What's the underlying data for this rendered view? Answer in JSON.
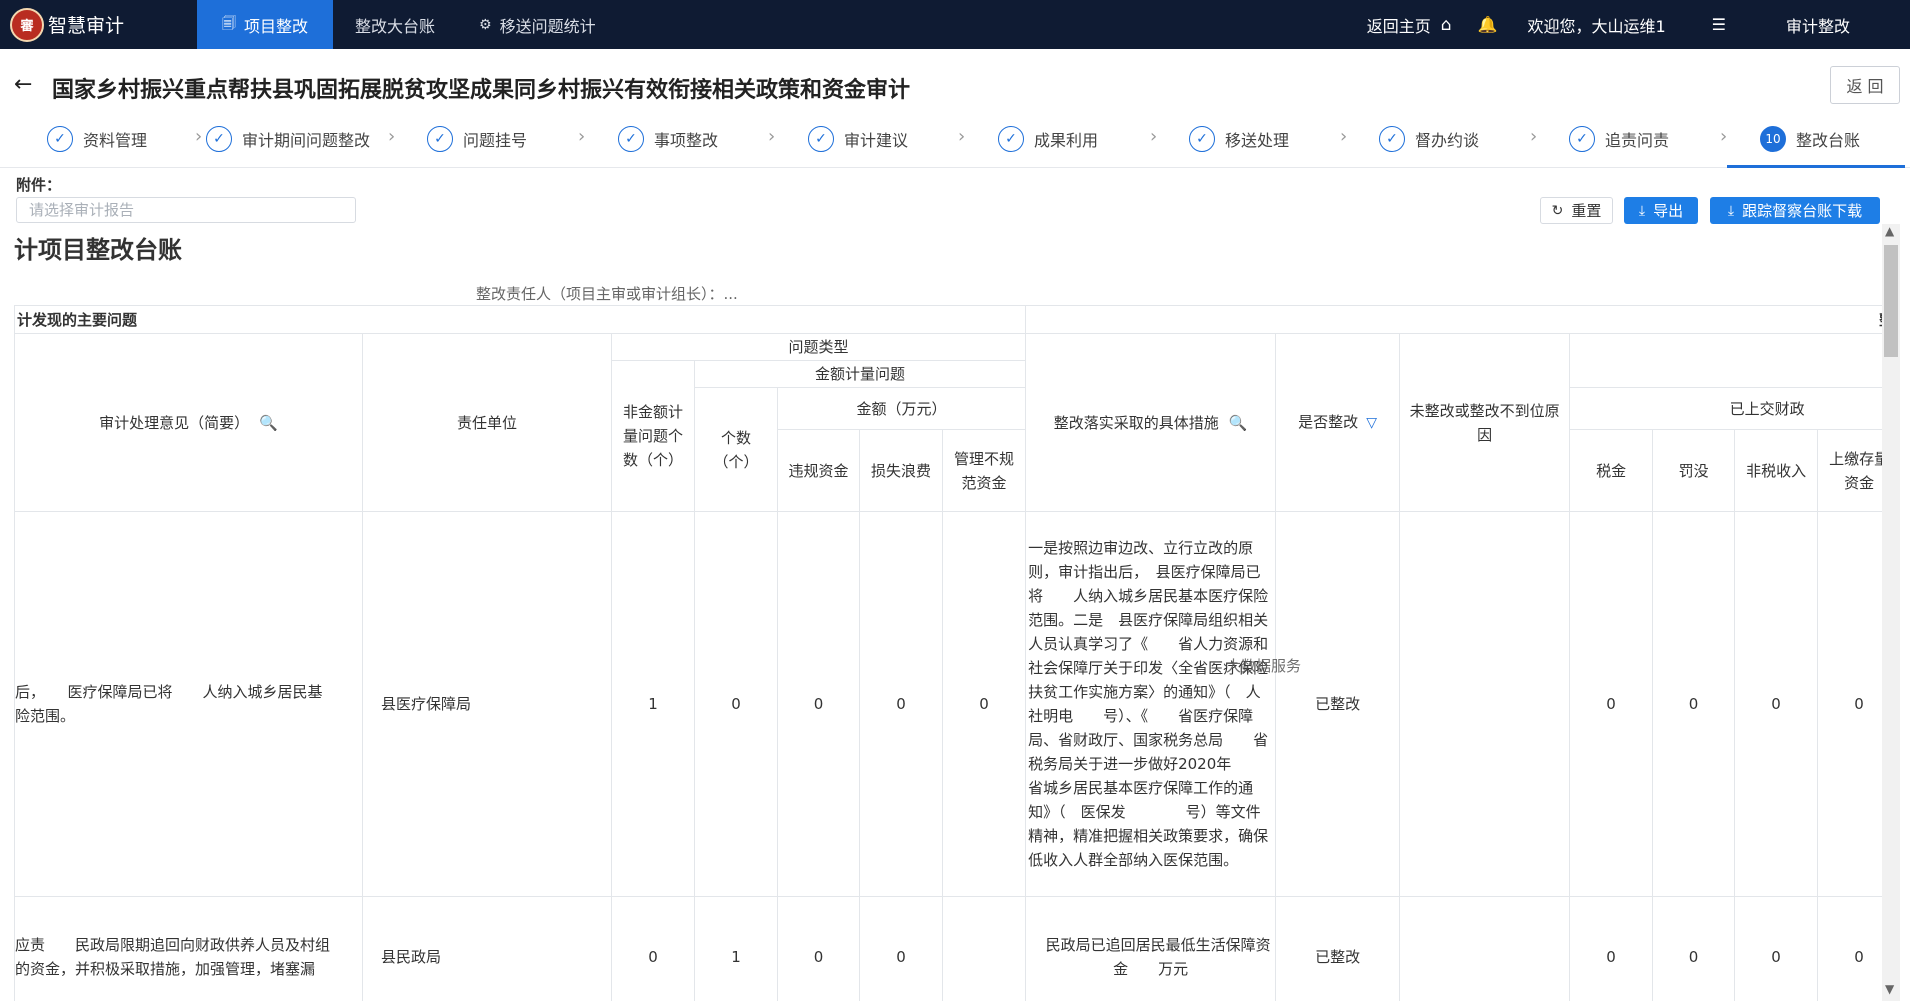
{
  "app": {
    "logo_glyph": "審",
    "name": "智慧审计"
  },
  "nav": {
    "tabs": [
      {
        "label": "项目整改",
        "active": true
      },
      {
        "label": "整改大台账",
        "active": false
      },
      {
        "label": "移送问题统计",
        "active": false
      }
    ],
    "home": "返回主页",
    "welcome": "欢迎您，大山运维1",
    "audit": "审计整改"
  },
  "title": {
    "text": "国家乡村振兴重点帮扶县巩固拓展脱贫攻坚成果同乡村振兴有效衔接相关政策和资金审计",
    "return_button": "返 回"
  },
  "steps": [
    {
      "label": "资料管理",
      "num": ""
    },
    {
      "label": "审计期间问题整改",
      "num": ""
    },
    {
      "label": "问题挂号",
      "num": ""
    },
    {
      "label": "事项整改",
      "num": ""
    },
    {
      "label": "审计建议",
      "num": ""
    },
    {
      "label": "成果利用",
      "num": ""
    },
    {
      "label": "移送处理",
      "num": ""
    },
    {
      "label": "督办约谈",
      "num": ""
    },
    {
      "label": "追责问责",
      "num": ""
    },
    {
      "label": "整改台账",
      "num": "10"
    }
  ],
  "attachment": {
    "label": "附件：",
    "placeholder": "请选择审计报告"
  },
  "buttons": {
    "reset": "重置",
    "export": "导出",
    "track_download": "跟踪督察台账下载"
  },
  "ledger": {
    "title": "计项目整改台账",
    "responsible": "整改责任人（项目主审或审计组长）：..."
  },
  "table": {
    "section_left": "计发现的主要问题",
    "section_right": "整",
    "headers": {
      "opinion": "审计处理意见（简要）",
      "unit": "责任单位",
      "problem_type": "问题类型",
      "non_amount": "非金额计量问题个数（个）",
      "amount_group": "金额计量问题",
      "count": "个数（个）",
      "amount": "金额（万元）",
      "violation": "违规资金",
      "loss": "损失浪费",
      "irregular": "管理不规范资金",
      "measures": "整改落实采取的具体措施",
      "rectified": "是否整改",
      "reason": "未整改或整改不到位原因",
      "handed": "已上交财政",
      "tax": "税金",
      "fine": "罚没",
      "nontax": "非税收入",
      "stock": "上缴存量资金"
    },
    "rows": [
      {
        "opinion": "后，　　医疗保障局已将　　人纳入城乡居民基\n险范围。",
        "unit": "县医疗保障局",
        "non_amount": "1",
        "count": "0",
        "violation": "0",
        "loss": "0",
        "irregular": "0",
        "measures": "一是按照边审边改、立行立改的原则，审计指出后，　县医疗保障局已将　　人纳入城乡居民基本医疗保险范围。二是　县医疗保障局组织相关人员认真学习了《　　省人力资源和社会保障厅关于印发〈全省医疗保险扶贫工作实施方案〉的通知》（　人社明电　　号）、《　　省医疗保障局、省财政厅、国家税务总局　　省税务局关于进一步做好2020年　　省城乡居民基本医疗保障工作的通知》（　医保发　　　　号）等文件精神，精准把握相关政策要求，确保低收入人群全部纳入医保范围。",
        "rectified": "已整改",
        "reason": "",
        "tax": "0",
        "fine": "0",
        "nontax": "0",
        "stock": "0"
      },
      {
        "opinion": "应责　　民政局限期追回向财政供养人员及村组\n的资金，并积极采取措施，加强管理，堵塞漏",
        "unit": "县民政局",
        "non_amount": "0",
        "count": "1",
        "violation": "0",
        "loss": "0",
        "irregular": "",
        "measures": "　民政局已追回居民最低生活保障资金　　万元",
        "rectified": "已整改",
        "reason": "",
        "tax": "0",
        "fine": "0",
        "nontax": "0",
        "stock": "0"
      }
    ],
    "overlay": "大数据服务"
  },
  "icons": {
    "project_tab": "document-icon",
    "stats_tab": "gear-icon",
    "home": "home-icon",
    "bell": "bell-icon",
    "menu": "list-icon",
    "back": "arrow-left-icon",
    "check": "check-circle-icon",
    "search": "search-icon",
    "filter": "filter-icon",
    "reset": "refresh-icon",
    "download": "download-icon"
  },
  "colors": {
    "nav_bg": "#0f1b33",
    "accent": "#1e6fd9",
    "button_blue": "#1e7ee6"
  }
}
